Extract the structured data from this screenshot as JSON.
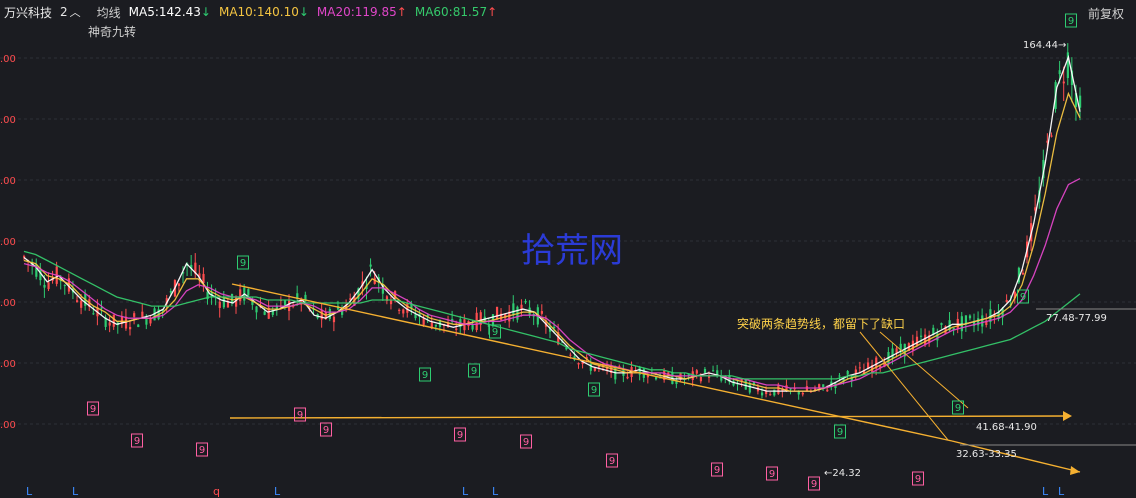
{
  "header": {
    "stock_name": "万兴科技",
    "stock_number": "2",
    "indicator_label": "均线",
    "ma": [
      {
        "label": "MA5:142.43",
        "arrow": "↓",
        "color": "#ffffff",
        "arrow_color": "#2ecc71"
      },
      {
        "label": "MA10:140.10",
        "arrow": "↓",
        "color": "#f5c542",
        "arrow_color": "#2ecc71"
      },
      {
        "label": "MA20:119.85",
        "arrow": "↑",
        "color": "#e046c8",
        "arrow_color": "#ff4d4f"
      },
      {
        "label": "MA60:81.57",
        "arrow": "↑",
        "color": "#35c96b",
        "arrow_color": "#ff4d4f"
      }
    ],
    "adjust_label": "前复权",
    "sub_label": "神奇九转"
  },
  "chart_data": {
    "type": "line",
    "title": "",
    "y_axis_labels": [
      ".00",
      ".00",
      ".00",
      ".00",
      ".00",
      ".00",
      ".00"
    ],
    "price_labels": [
      "164.44",
      "77.48-77.99",
      "41.68-41.90",
      "32.63-33.35",
      "24.32"
    ],
    "annotation": "突破两条趋势线，都留下了缺口",
    "watermark": "拾荒网",
    "bottom_markers": [
      "L",
      "L",
      "q",
      "L",
      "L",
      "L",
      "L",
      "L"
    ],
    "nine_turn_top_labels": [
      "9",
      "9",
      "9",
      "9",
      "9",
      "9",
      "9",
      "9",
      "9"
    ],
    "nine_turn_bottom_labels": [
      "9",
      "9",
      "9",
      "9",
      "9",
      "9",
      "9",
      "9",
      "9",
      "9",
      "9",
      "9"
    ],
    "colors": {
      "ma5": "#ffffff",
      "ma10": "#f5c542",
      "ma20": "#e046c8",
      "ma60": "#35c96b",
      "trendline": "#f5b031",
      "up": "#ff4d4f",
      "down": "#2ecc71",
      "nine": "#ff5fa2"
    },
    "series": [
      {
        "name": "MA5",
        "values": [
          94,
          91,
          86,
          88,
          84,
          80,
          77,
          74,
          72,
          73,
          74,
          75,
          77,
          84,
          92,
          88,
          82,
          80,
          79,
          82,
          79,
          76,
          77,
          79,
          80,
          75,
          74,
          76,
          79,
          84,
          90,
          84,
          80,
          77,
          75,
          73,
          72,
          71,
          72,
          73,
          74,
          75,
          76,
          77,
          76,
          72,
          68,
          64,
          60,
          58,
          57,
          56,
          56,
          57,
          56,
          55,
          54,
          54,
          55,
          56,
          55,
          53,
          52,
          51,
          50,
          50,
          50,
          50,
          50,
          51,
          53,
          55,
          56,
          58,
          60,
          62,
          64,
          66,
          68,
          70,
          72,
          72,
          73,
          74,
          76,
          80,
          90,
          105,
          125,
          150,
          160,
          142
        ]
      },
      {
        "name": "MA10",
        "values": [
          93,
          92,
          88,
          87,
          85,
          81,
          78,
          76,
          73,
          73,
          74,
          74,
          76,
          80,
          87,
          87,
          83,
          81,
          80,
          81,
          79,
          77,
          77,
          78,
          79,
          77,
          75,
          76,
          78,
          82,
          87,
          85,
          81,
          78,
          76,
          74,
          73,
          72,
          72,
          73,
          73,
          74,
          75,
          76,
          76,
          73,
          69,
          65,
          62,
          59,
          58,
          57,
          56,
          56,
          56,
          55,
          55,
          54,
          55,
          55,
          55,
          54,
          53,
          52,
          51,
          51,
          50,
          50,
          50,
          51,
          52,
          54,
          55,
          57,
          59,
          61,
          63,
          65,
          67,
          69,
          71,
          72,
          73,
          74,
          75,
          78,
          85,
          98,
          115,
          135,
          148,
          140
        ]
      },
      {
        "name": "MA20",
        "values": [
          92,
          91,
          89,
          88,
          86,
          83,
          80,
          77,
          75,
          74,
          74,
          74,
          75,
          78,
          83,
          85,
          84,
          82,
          81,
          81,
          80,
          78,
          78,
          78,
          79,
          78,
          76,
          76,
          77,
          80,
          84,
          84,
          82,
          80,
          77,
          75,
          74,
          73,
          72,
          72,
          73,
          73,
          74,
          75,
          75,
          74,
          71,
          67,
          64,
          61,
          59,
          58,
          57,
          56,
          56,
          56,
          55,
          55,
          55,
          55,
          55,
          54,
          54,
          53,
          52,
          52,
          51,
          51,
          51,
          51,
          52,
          53,
          54,
          56,
          58,
          60,
          62,
          64,
          66,
          68,
          70,
          71,
          72,
          73,
          74,
          76,
          80,
          88,
          98,
          110,
          118,
          120
        ]
      },
      {
        "name": "MA60",
        "values": [
          96,
          95,
          93,
          91,
          89,
          87,
          85,
          83,
          81,
          80,
          79,
          78,
          78,
          78,
          79,
          80,
          81,
          81,
          81,
          81,
          81,
          80,
          80,
          80,
          79,
          79,
          79,
          79,
          79,
          79,
          80,
          80,
          80,
          79,
          78,
          77,
          76,
          75,
          74,
          73,
          72,
          71,
          70,
          69,
          68,
          67,
          66,
          64,
          63,
          62,
          61,
          60,
          59,
          58,
          57,
          57,
          56,
          56,
          55,
          55,
          55,
          55,
          54,
          54,
          54,
          54,
          54,
          54,
          54,
          54,
          54,
          55,
          55,
          56,
          56,
          57,
          58,
          59,
          60,
          61,
          62,
          63,
          64,
          65,
          66,
          67,
          69,
          71,
          73,
          76,
          79,
          82
        ]
      }
    ]
  }
}
